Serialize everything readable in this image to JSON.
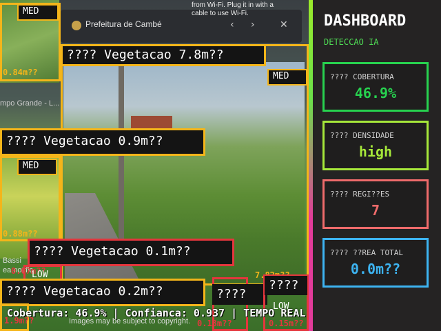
{
  "browser": {
    "title": "Prefeitura de Cambé",
    "wifi_hint": "cable to use Wi-Fi.",
    "wifi_hint_top": "from Wi-Fi. Plug it in with a"
  },
  "scene_text": {
    "side_link": "mpo Grande - L...",
    "footer_line1": "Images may be subject to copyright.",
    "footer_line2": "Bassi",
    "footer_line3": "ea notific"
  },
  "detections": {
    "tag_med_1": "MED",
    "tag_med_2": "MED",
    "tag_med_3": "MED",
    "tag_low_1": "LOW",
    "tag_low_2": "LOW",
    "label_1": "???? Vegetacao 7.8m??",
    "label_2": "???? Vegetacao 0.9m??",
    "label_3": "???? Vegetacao 0.1m??",
    "label_4": "???? Vegetacao 0.2m??",
    "label_5": "????",
    "label_6": "????",
    "meas_1": "0.84m??",
    "meas_2": "0.88m??",
    "meas_3": "0.07m??",
    "meas_4": "7.82m??",
    "meas_5": "1.9m??",
    "meas_6": "0.13m??",
    "meas_7": "0.15m??"
  },
  "status_bar": "Cobertura: 46.9% | Confianca: 0.937 | TEMPO REAL",
  "dashboard": {
    "title": "DASHBOARD",
    "subtitle": "DETECCAO IA",
    "cards": [
      {
        "label": "???? COBERTURA",
        "value": "46.9%",
        "color": "#27d24f"
      },
      {
        "label": "???? DENSIDADE",
        "value": "high",
        "color": "#a6e83a"
      },
      {
        "label": "???? REGI??ES",
        "value": "7",
        "color": "#ef6b6b"
      },
      {
        "label": "???? ??REA TOTAL",
        "value": "0.0m??",
        "color": "#3db4f2"
      }
    ]
  },
  "colors": {
    "med": "#f4b51a",
    "low": "#e4363d"
  }
}
